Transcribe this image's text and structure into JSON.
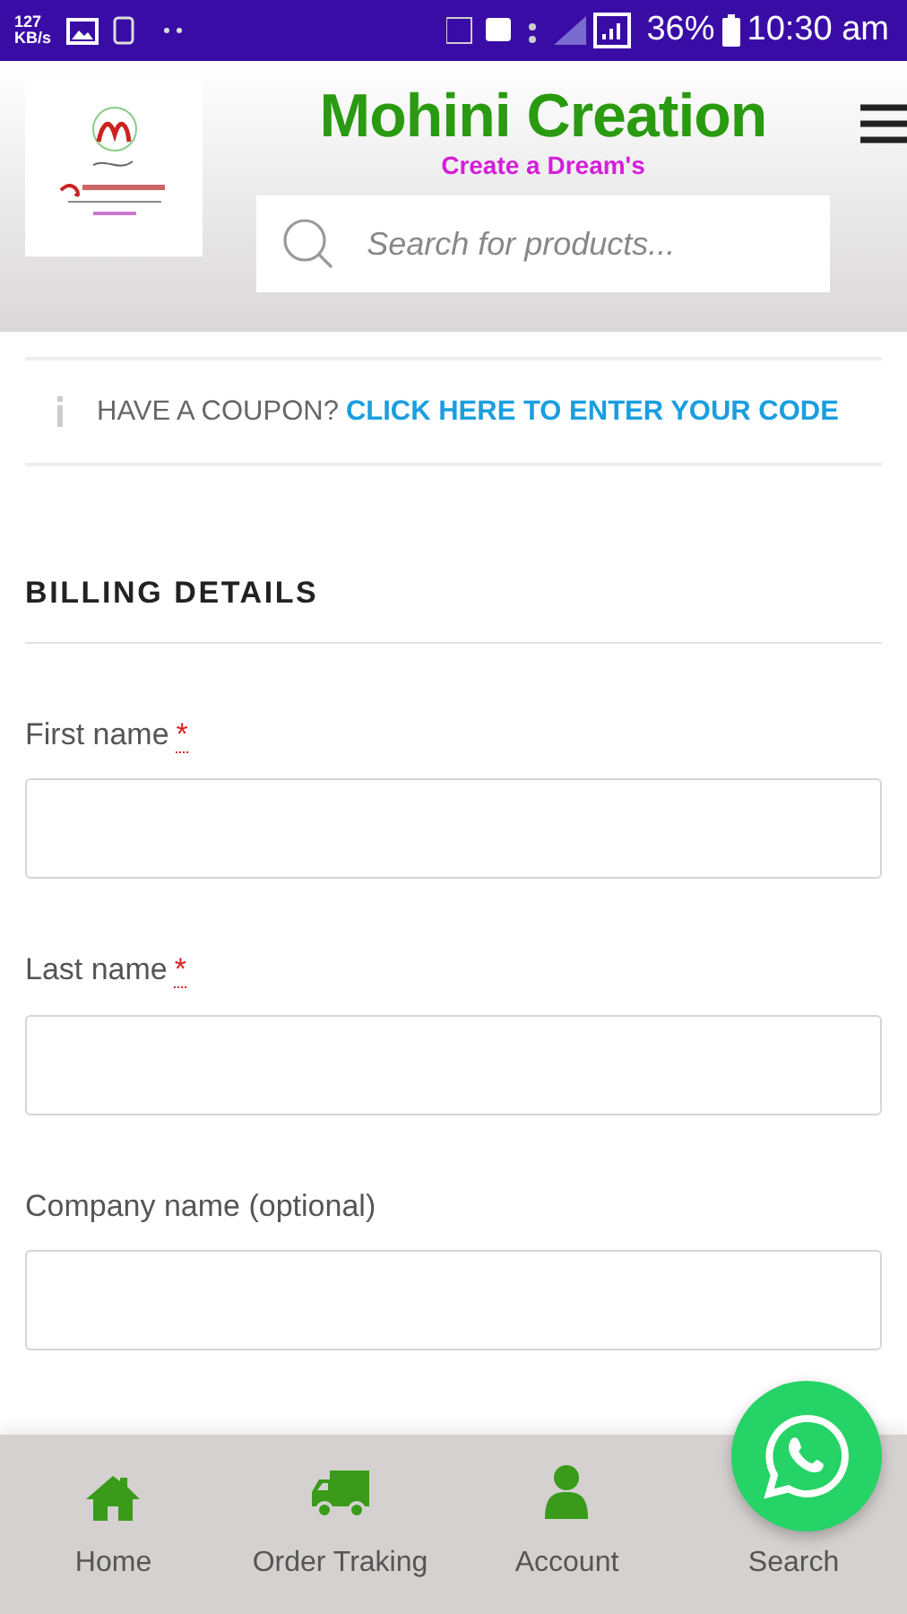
{
  "status_bar": {
    "speed": "127",
    "speed_unit": "KB/s",
    "battery": "36%",
    "time": "10:30 am"
  },
  "header": {
    "title": "Mohini Creation",
    "tagline": "Create a Dream's",
    "search": {
      "placeholder": "Search for products..."
    }
  },
  "coupon": {
    "text": "HAVE A COUPON?",
    "link": "CLICK HERE TO ENTER YOUR CODE"
  },
  "billing": {
    "heading": "BILLING DETAILS",
    "fields": [
      {
        "label": "First name",
        "required_mark": "*"
      },
      {
        "label": "Last name",
        "required_mark": "*"
      },
      {
        "label": "Company name (optional)"
      }
    ]
  },
  "bottom_nav": [
    {
      "kind": "home",
      "label": "Home"
    },
    {
      "kind": "truck",
      "label": "Order Traking"
    },
    {
      "kind": "user",
      "label": "Account"
    },
    {
      "label": "Search"
    }
  ]
}
